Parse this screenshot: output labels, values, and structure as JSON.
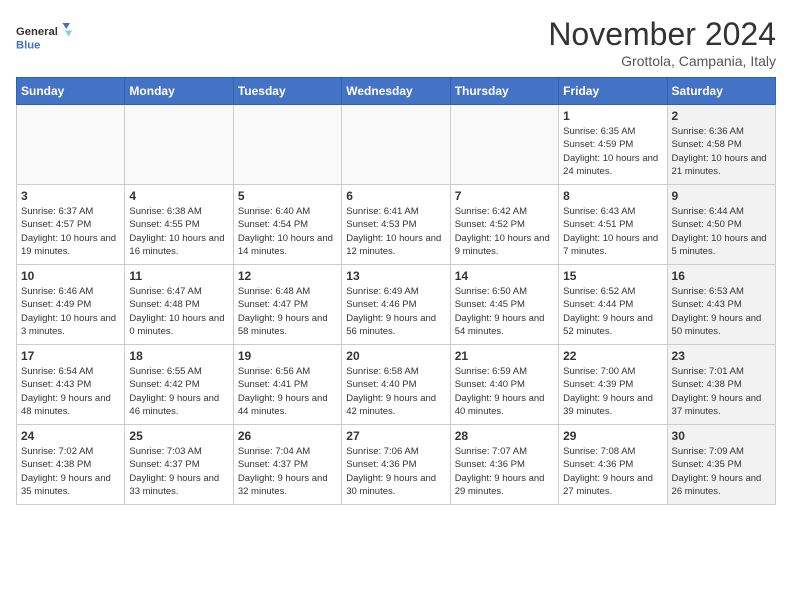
{
  "header": {
    "logo_line1": "General",
    "logo_line2": "Blue",
    "month_title": "November 2024",
    "location": "Grottola, Campania, Italy"
  },
  "days_of_week": [
    "Sunday",
    "Monday",
    "Tuesday",
    "Wednesday",
    "Thursday",
    "Friday",
    "Saturday"
  ],
  "weeks": [
    [
      {
        "day": "",
        "info": "",
        "empty": true
      },
      {
        "day": "",
        "info": "",
        "empty": true
      },
      {
        "day": "",
        "info": "",
        "empty": true
      },
      {
        "day": "",
        "info": "",
        "empty": true
      },
      {
        "day": "",
        "info": "",
        "empty": true
      },
      {
        "day": "1",
        "info": "Sunrise: 6:35 AM\nSunset: 4:59 PM\nDaylight: 10 hours and 24 minutes.",
        "empty": false,
        "shaded": false
      },
      {
        "day": "2",
        "info": "Sunrise: 6:36 AM\nSunset: 4:58 PM\nDaylight: 10 hours and 21 minutes.",
        "empty": false,
        "shaded": true
      }
    ],
    [
      {
        "day": "3",
        "info": "Sunrise: 6:37 AM\nSunset: 4:57 PM\nDaylight: 10 hours and 19 minutes.",
        "empty": false,
        "shaded": false
      },
      {
        "day": "4",
        "info": "Sunrise: 6:38 AM\nSunset: 4:55 PM\nDaylight: 10 hours and 16 minutes.",
        "empty": false,
        "shaded": false
      },
      {
        "day": "5",
        "info": "Sunrise: 6:40 AM\nSunset: 4:54 PM\nDaylight: 10 hours and 14 minutes.",
        "empty": false,
        "shaded": false
      },
      {
        "day": "6",
        "info": "Sunrise: 6:41 AM\nSunset: 4:53 PM\nDaylight: 10 hours and 12 minutes.",
        "empty": false,
        "shaded": false
      },
      {
        "day": "7",
        "info": "Sunrise: 6:42 AM\nSunset: 4:52 PM\nDaylight: 10 hours and 9 minutes.",
        "empty": false,
        "shaded": false
      },
      {
        "day": "8",
        "info": "Sunrise: 6:43 AM\nSunset: 4:51 PM\nDaylight: 10 hours and 7 minutes.",
        "empty": false,
        "shaded": false
      },
      {
        "day": "9",
        "info": "Sunrise: 6:44 AM\nSunset: 4:50 PM\nDaylight: 10 hours and 5 minutes.",
        "empty": false,
        "shaded": true
      }
    ],
    [
      {
        "day": "10",
        "info": "Sunrise: 6:46 AM\nSunset: 4:49 PM\nDaylight: 10 hours and 3 minutes.",
        "empty": false,
        "shaded": false
      },
      {
        "day": "11",
        "info": "Sunrise: 6:47 AM\nSunset: 4:48 PM\nDaylight: 10 hours and 0 minutes.",
        "empty": false,
        "shaded": false
      },
      {
        "day": "12",
        "info": "Sunrise: 6:48 AM\nSunset: 4:47 PM\nDaylight: 9 hours and 58 minutes.",
        "empty": false,
        "shaded": false
      },
      {
        "day": "13",
        "info": "Sunrise: 6:49 AM\nSunset: 4:46 PM\nDaylight: 9 hours and 56 minutes.",
        "empty": false,
        "shaded": false
      },
      {
        "day": "14",
        "info": "Sunrise: 6:50 AM\nSunset: 4:45 PM\nDaylight: 9 hours and 54 minutes.",
        "empty": false,
        "shaded": false
      },
      {
        "day": "15",
        "info": "Sunrise: 6:52 AM\nSunset: 4:44 PM\nDaylight: 9 hours and 52 minutes.",
        "empty": false,
        "shaded": false
      },
      {
        "day": "16",
        "info": "Sunrise: 6:53 AM\nSunset: 4:43 PM\nDaylight: 9 hours and 50 minutes.",
        "empty": false,
        "shaded": true
      }
    ],
    [
      {
        "day": "17",
        "info": "Sunrise: 6:54 AM\nSunset: 4:43 PM\nDaylight: 9 hours and 48 minutes.",
        "empty": false,
        "shaded": false
      },
      {
        "day": "18",
        "info": "Sunrise: 6:55 AM\nSunset: 4:42 PM\nDaylight: 9 hours and 46 minutes.",
        "empty": false,
        "shaded": false
      },
      {
        "day": "19",
        "info": "Sunrise: 6:56 AM\nSunset: 4:41 PM\nDaylight: 9 hours and 44 minutes.",
        "empty": false,
        "shaded": false
      },
      {
        "day": "20",
        "info": "Sunrise: 6:58 AM\nSunset: 4:40 PM\nDaylight: 9 hours and 42 minutes.",
        "empty": false,
        "shaded": false
      },
      {
        "day": "21",
        "info": "Sunrise: 6:59 AM\nSunset: 4:40 PM\nDaylight: 9 hours and 40 minutes.",
        "empty": false,
        "shaded": false
      },
      {
        "day": "22",
        "info": "Sunrise: 7:00 AM\nSunset: 4:39 PM\nDaylight: 9 hours and 39 minutes.",
        "empty": false,
        "shaded": false
      },
      {
        "day": "23",
        "info": "Sunrise: 7:01 AM\nSunset: 4:38 PM\nDaylight: 9 hours and 37 minutes.",
        "empty": false,
        "shaded": true
      }
    ],
    [
      {
        "day": "24",
        "info": "Sunrise: 7:02 AM\nSunset: 4:38 PM\nDaylight: 9 hours and 35 minutes.",
        "empty": false,
        "shaded": false
      },
      {
        "day": "25",
        "info": "Sunrise: 7:03 AM\nSunset: 4:37 PM\nDaylight: 9 hours and 33 minutes.",
        "empty": false,
        "shaded": false
      },
      {
        "day": "26",
        "info": "Sunrise: 7:04 AM\nSunset: 4:37 PM\nDaylight: 9 hours and 32 minutes.",
        "empty": false,
        "shaded": false
      },
      {
        "day": "27",
        "info": "Sunrise: 7:06 AM\nSunset: 4:36 PM\nDaylight: 9 hours and 30 minutes.",
        "empty": false,
        "shaded": false
      },
      {
        "day": "28",
        "info": "Sunrise: 7:07 AM\nSunset: 4:36 PM\nDaylight: 9 hours and 29 minutes.",
        "empty": false,
        "shaded": false
      },
      {
        "day": "29",
        "info": "Sunrise: 7:08 AM\nSunset: 4:36 PM\nDaylight: 9 hours and 27 minutes.",
        "empty": false,
        "shaded": false
      },
      {
        "day": "30",
        "info": "Sunrise: 7:09 AM\nSunset: 4:35 PM\nDaylight: 9 hours and 26 minutes.",
        "empty": false,
        "shaded": true
      }
    ]
  ]
}
